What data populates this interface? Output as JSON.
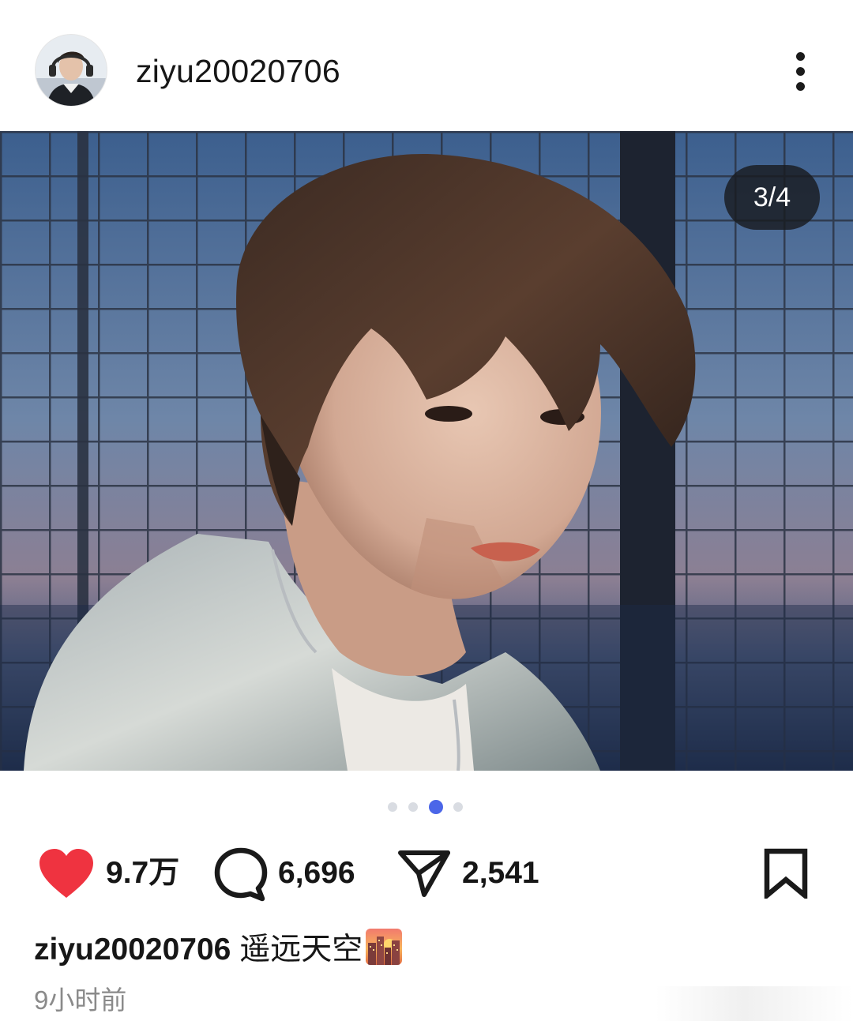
{
  "post": {
    "username": "ziyu20020706",
    "counter": "3/4",
    "carousel": {
      "total": 4,
      "active_index": 3
    },
    "stats": {
      "likes": "9.7万",
      "comments": "6,696",
      "shares": "2,541"
    },
    "caption": {
      "author": "ziyu20020706",
      "text": "遥远天空",
      "emoji": "city-dusk-emoji"
    },
    "timestamp": "9小时前"
  },
  "icons": {
    "more": "more-vertical-icon",
    "like": "heart-filled-icon",
    "comment": "comment-bubble-icon",
    "share": "send-paper-plane-icon",
    "save": "bookmark-icon"
  },
  "colors": {
    "like": "#ef3340",
    "active_dot": "#4b66e8",
    "inactive_dot": "#d9dce2",
    "counter_bg": "#1b1e23",
    "timestamp": "#8a8a8a"
  }
}
